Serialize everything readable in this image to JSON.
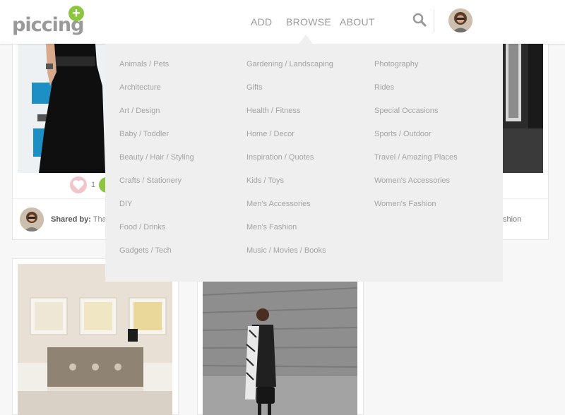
{
  "header": {
    "logo_text": "piccing",
    "logo_plus": "+",
    "nav": {
      "add": "ADD",
      "browse": "BROWSE",
      "about": "ABOUT"
    },
    "icons": {
      "search": "search-icon",
      "avatar": "user-avatar"
    }
  },
  "browse_menu": {
    "columns": [
      [
        "Animals / Pets",
        "Architecture",
        "Art / Design",
        "Baby / Toddler",
        "Beauty / Hair / Styling",
        "Crafts / Stationery",
        "DIY",
        "Food / Drinks",
        "Gadgets / Tech"
      ],
      [
        "Gardening / Landscaping",
        "Gifts",
        "Health / Fitness",
        "Home / Decor",
        "Inspiration / Quotes",
        "Kids / Toys",
        "Men's Accessories",
        "Men's Fashion",
        "Music / Movies / Books"
      ],
      [
        "Photography",
        "Rides",
        "Special Occasions",
        "Sports / Outdoor",
        "Travel / Amazing Places",
        "Women's Accessories",
        "Women's Fashion"
      ]
    ]
  },
  "feed": {
    "card1": {
      "like_count": "1",
      "shared_label": "Shared by:",
      "shared_name": "Tha",
      "category_tail": "shion"
    }
  },
  "colors": {
    "accent": "#8cc63f",
    "menu_bg": "#efefef",
    "menu_text": "#a3a3a3",
    "nav_text": "#9a9a9a"
  }
}
